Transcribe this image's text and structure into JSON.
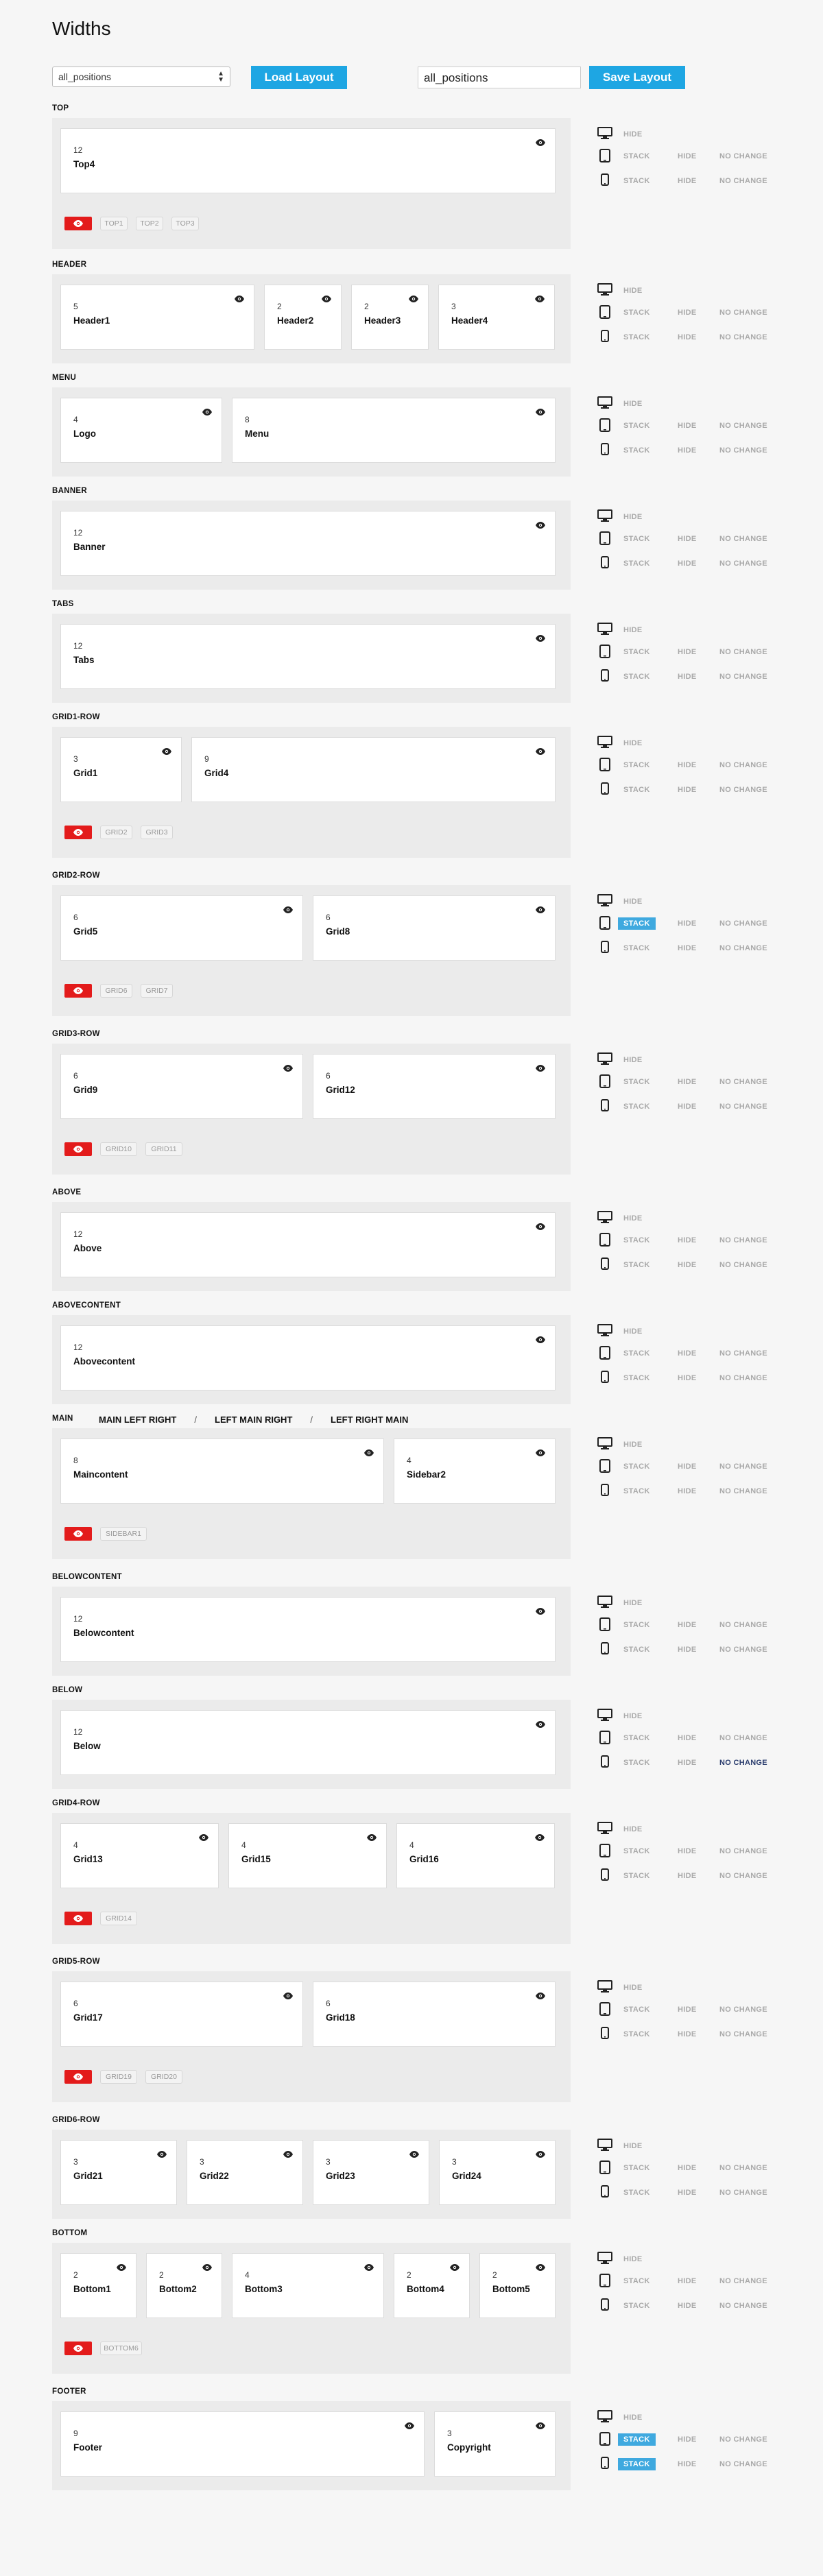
{
  "page": {
    "title": "Widths"
  },
  "toolbar": {
    "select_value": "all_positions",
    "load_label": "Load Layout",
    "input_value": "all_positions",
    "save_label": "Save Layout"
  },
  "device_options": {
    "hide": "HIDE",
    "stack": "STACK",
    "no_change": "NO CHANGE"
  },
  "device_icons": [
    "desktop-icon",
    "tablet-icon",
    "phone-icon"
  ],
  "colors": {
    "accent": "#1ea6e3",
    "hidden_toggle": "#e31b1b",
    "stack_active": "#3fa9df",
    "no_change_active": "#2b3d6e"
  },
  "main_layouts": [
    "MAIN LEFT RIGHT",
    "LEFT MAIN RIGHT",
    "LEFT RIGHT MAIN"
  ],
  "sections": [
    {
      "label": "TOP",
      "columns": [
        {
          "width": 12,
          "name": "Top4"
        }
      ],
      "hidden": [
        "TOP1",
        "TOP2",
        "TOP3"
      ],
      "tablet_active": null,
      "phone_active": null
    },
    {
      "label": "HEADER",
      "columns": [
        {
          "width": 5,
          "name": "Header1"
        },
        {
          "width": 2,
          "name": "Header2"
        },
        {
          "width": 2,
          "name": "Header3"
        },
        {
          "width": 3,
          "name": "Header4"
        }
      ],
      "hidden": [],
      "tablet_active": null,
      "phone_active": null
    },
    {
      "label": "MENU",
      "columns": [
        {
          "width": 4,
          "name": "Logo"
        },
        {
          "width": 8,
          "name": "Menu"
        }
      ],
      "hidden": [],
      "tablet_active": null,
      "phone_active": null
    },
    {
      "label": "BANNER",
      "columns": [
        {
          "width": 12,
          "name": "Banner"
        }
      ],
      "hidden": [],
      "tablet_active": null,
      "phone_active": null
    },
    {
      "label": "TABS",
      "columns": [
        {
          "width": 12,
          "name": "Tabs"
        }
      ],
      "hidden": [],
      "tablet_active": null,
      "phone_active": null
    },
    {
      "label": "GRID1-ROW",
      "columns": [
        {
          "width": 3,
          "name": "Grid1"
        },
        {
          "width": 9,
          "name": "Grid4"
        }
      ],
      "hidden": [
        "GRID2",
        "GRID3"
      ],
      "tablet_active": null,
      "phone_active": null
    },
    {
      "label": "GRID2-ROW",
      "columns": [
        {
          "width": 6,
          "name": "Grid5"
        },
        {
          "width": 6,
          "name": "Grid8"
        }
      ],
      "hidden": [
        "GRID6",
        "GRID7"
      ],
      "tablet_active": "stack",
      "phone_active": null
    },
    {
      "label": "GRID3-ROW",
      "columns": [
        {
          "width": 6,
          "name": "Grid9"
        },
        {
          "width": 6,
          "name": "Grid12"
        }
      ],
      "hidden": [
        "GRID10",
        "GRID11"
      ],
      "tablet_active": null,
      "phone_active": null
    },
    {
      "label": "ABOVE",
      "columns": [
        {
          "width": 12,
          "name": "Above"
        }
      ],
      "hidden": [],
      "tablet_active": null,
      "phone_active": null
    },
    {
      "label": "ABOVECONTENT",
      "columns": [
        {
          "width": 12,
          "name": "Abovecontent"
        }
      ],
      "hidden": [],
      "tablet_active": null,
      "phone_active": null
    },
    {
      "label": "MAIN",
      "columns": [
        {
          "width": 8,
          "name": "Maincontent"
        },
        {
          "width": 4,
          "name": "Sidebar2"
        }
      ],
      "hidden": [
        "SIDEBAR1"
      ],
      "tablet_active": null,
      "phone_active": null
    },
    {
      "label": "BELOWCONTENT",
      "columns": [
        {
          "width": 12,
          "name": "Belowcontent"
        }
      ],
      "hidden": [],
      "tablet_active": null,
      "phone_active": null
    },
    {
      "label": "BELOW",
      "columns": [
        {
          "width": 12,
          "name": "Below"
        }
      ],
      "hidden": [],
      "tablet_active": null,
      "phone_active": "no_change"
    },
    {
      "label": "GRID4-ROW",
      "columns": [
        {
          "width": 4,
          "name": "Grid13"
        },
        {
          "width": 4,
          "name": "Grid15"
        },
        {
          "width": 4,
          "name": "Grid16"
        }
      ],
      "hidden": [
        "GRID14"
      ],
      "tablet_active": null,
      "phone_active": null
    },
    {
      "label": "GRID5-ROW",
      "columns": [
        {
          "width": 6,
          "name": "Grid17"
        },
        {
          "width": 6,
          "name": "Grid18"
        }
      ],
      "hidden": [
        "GRID19",
        "GRID20"
      ],
      "tablet_active": null,
      "phone_active": null
    },
    {
      "label": "GRID6-ROW",
      "columns": [
        {
          "width": 3,
          "name": "Grid21"
        },
        {
          "width": 3,
          "name": "Grid22"
        },
        {
          "width": 3,
          "name": "Grid23"
        },
        {
          "width": 3,
          "name": "Grid24"
        }
      ],
      "hidden": [],
      "tablet_active": null,
      "phone_active": null
    },
    {
      "label": "BOTTOM",
      "columns": [
        {
          "width": 2,
          "name": "Bottom1"
        },
        {
          "width": 2,
          "name": "Bottom2"
        },
        {
          "width": 4,
          "name": "Bottom3"
        },
        {
          "width": 2,
          "name": "Bottom4"
        },
        {
          "width": 2,
          "name": "Bottom5"
        }
      ],
      "hidden": [
        "BOTTOM6"
      ],
      "tablet_active": null,
      "phone_active": null
    },
    {
      "label": "FOOTER",
      "columns": [
        {
          "width": 9,
          "name": "Footer"
        },
        {
          "width": 3,
          "name": "Copyright"
        }
      ],
      "hidden": [],
      "tablet_active": "stack",
      "phone_active": "stack"
    }
  ]
}
